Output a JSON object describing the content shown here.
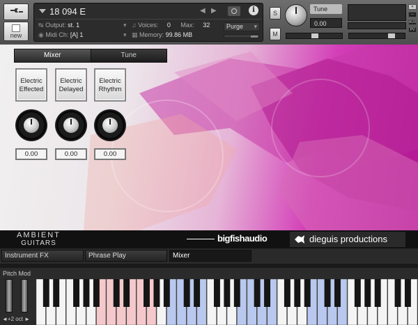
{
  "header": {
    "new_label": "new",
    "instrument_name": "18 094 E",
    "output_label": "Output:",
    "output_value": "st. 1",
    "midi_label": "Midi Ch:",
    "midi_value": "[A] 1",
    "voices_label": "Voices:",
    "voices_value": "0",
    "max_label": "Max:",
    "max_value": "32",
    "memory_label": "Memory:",
    "memory_value": "99.86 MB",
    "purge_label": "Purge",
    "solo_label": "S",
    "mute_label": "M",
    "tune_label": "Tune",
    "tune_value": "0.00",
    "side_buttons": [
      "AUX",
      "PV"
    ]
  },
  "panel": {
    "tabs": [
      "Mixer",
      "Tune"
    ],
    "channels": [
      {
        "line1": "Electric",
        "line2": "Effected",
        "value": "0.00"
      },
      {
        "line1": "Electric",
        "line2": "Delayed",
        "value": "0.00"
      },
      {
        "line1": "Electric",
        "line2": "Rhythm",
        "value": "0.00"
      }
    ]
  },
  "brand": {
    "product_line1": "AMBIENT",
    "product_line2": "GUITARS",
    "publisher": "bigfishaudio",
    "developer": "dieguis productions"
  },
  "bottom_tabs": [
    "Instrument FX",
    "Phrase Play",
    "Mixer"
  ],
  "keyboard": {
    "pitch_mod_label": "Pitch Mod",
    "octave_label": "◄+2 oct ►",
    "white_key_count": 38,
    "zones": [
      {
        "from": 6,
        "to": 11,
        "color": "#f5c9cc"
      },
      {
        "from": 13,
        "to": 16,
        "color": "#b8c8ee"
      },
      {
        "from": 20,
        "to": 23,
        "color": "#b8c8ee"
      },
      {
        "from": 27,
        "to": 30,
        "color": "#b8c8ee"
      }
    ]
  }
}
